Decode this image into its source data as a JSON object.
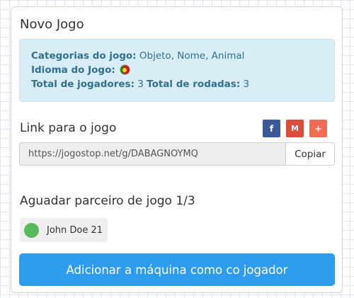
{
  "card": {
    "title": "Novo Jogo"
  },
  "info": {
    "categories_label": "Categorias do jogo:",
    "categories_value": "Objeto, Nome, Animal",
    "language_label": "Idioma do Jogo:",
    "language_icon": "portugal-flag-icon",
    "players_label": "Total de jogadores:",
    "players_value": "3",
    "rounds_label": "Total de rodadas:",
    "rounds_value": "3"
  },
  "link": {
    "label": "Link para o jogo",
    "url": "https://jogostop.net/g/DABAGNOYMQ",
    "copy_label": "Copiar",
    "share": {
      "facebook": "f",
      "gmail": "M",
      "googleplus": "+"
    }
  },
  "waiting": {
    "label": "Aguadar parceiro de jogo 1/3"
  },
  "players": [
    {
      "name": "John Doe 21",
      "status_color": "#5cb85c"
    }
  ],
  "actions": {
    "add_machine": "Adicionar a máquina como co jogador"
  },
  "colors": {
    "info_bg": "#d9edf7",
    "info_text": "#31708f",
    "primary": "#2d9cef",
    "facebook": "#3b5998",
    "gmail": "#dd4b39",
    "googleplus": "#f26b53"
  }
}
